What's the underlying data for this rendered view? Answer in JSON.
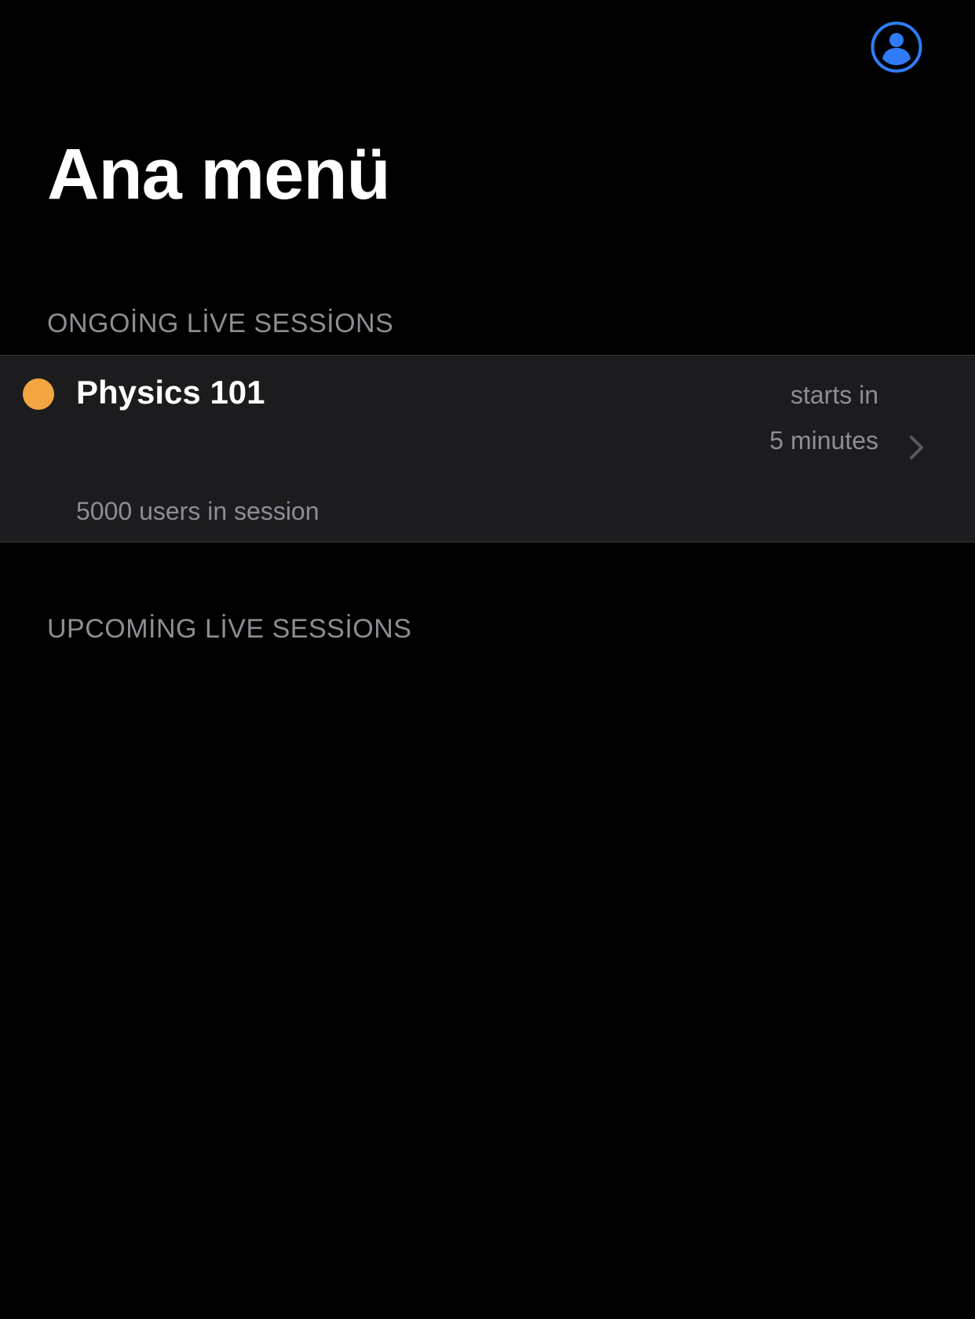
{
  "header": {
    "profile_icon": "person-circle-icon",
    "title": "Ana menü",
    "accent_color": "#2f7cf6"
  },
  "sections": {
    "ongoing": {
      "header": "ONGOİNG LİVE SESSİONS",
      "items": [
        {
          "title": "Physics 101",
          "status_color": "#f2a541",
          "starts_label": "starts in",
          "starts_value": "5 minutes",
          "users": "5000 users in session",
          "chevron_icon": "chevron-right-icon"
        }
      ]
    },
    "upcoming": {
      "header": "UPCOMİNG LİVE SESSİONS"
    }
  }
}
